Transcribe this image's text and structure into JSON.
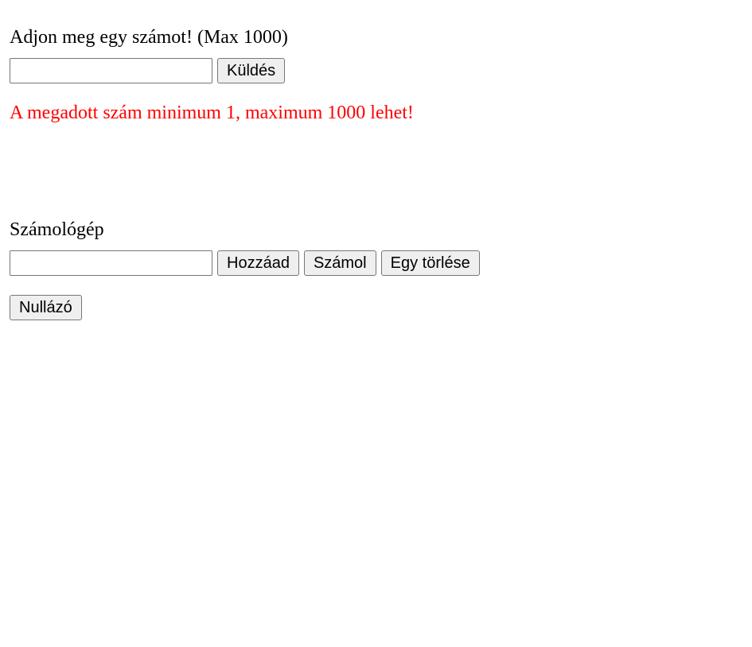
{
  "number_form": {
    "prompt": "Adjon meg egy számot! (Max 1000)",
    "input_value": "",
    "input_placeholder": "",
    "submit_label": "Küldés",
    "error_message": "A megadott szám minimum 1, maximum 1000 lehet!",
    "error_color": "#ff0000"
  },
  "calculator": {
    "title": "Számológép",
    "input_value": "",
    "input_placeholder": "",
    "add_label": "Hozzáad",
    "calculate_label": "Számol",
    "delete_one_label": "Egy törlése",
    "reset_label": "Nullázó"
  }
}
